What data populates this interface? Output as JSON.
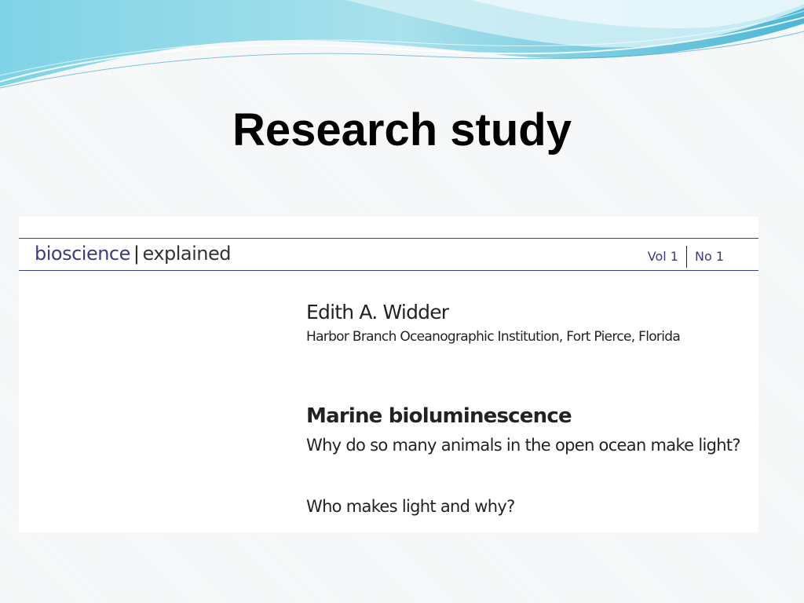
{
  "slide": {
    "title": "Research study"
  },
  "document": {
    "brand": {
      "part1": "bioscience",
      "separator": "|",
      "part2": "explained"
    },
    "volume": {
      "vol": "Vol 1",
      "no": "No 1"
    },
    "author": "Edith A. Widder",
    "affiliation": "Harbor Branch Oceanographic Institution, Fort Pierce, Florida",
    "article_title": "Marine bioluminescence",
    "article_subtitle": "Why do so many animals in the open ocean make light?",
    "section_heading": "Who makes light and why?"
  },
  "colors": {
    "brand_blue": "#3d3d7a",
    "rule": "#3b3f8f",
    "wave_light": "#bfe6ef",
    "wave_mid": "#6ccbe0",
    "wave_dark": "#39a9cc"
  }
}
